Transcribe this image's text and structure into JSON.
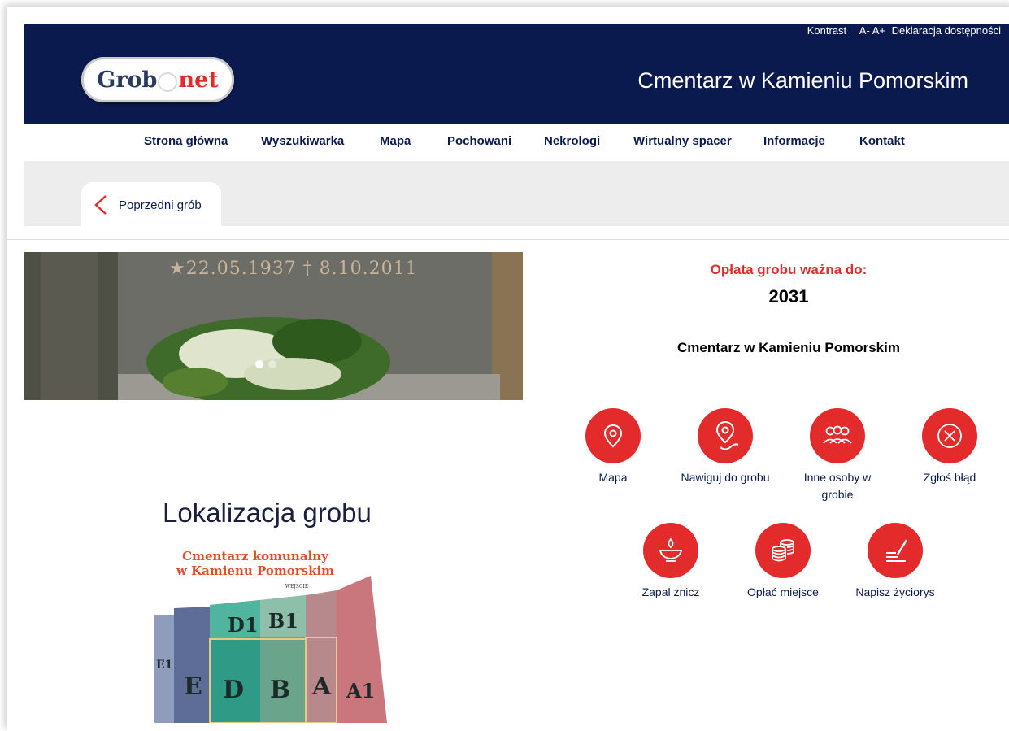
{
  "header": {
    "util": [
      "Kontrast",
      "A- A+",
      "Deklaracja dostępności"
    ],
    "logo": {
      "grob": "Grob",
      "net": "net"
    },
    "site_title": "Cmentarz w Kamieniu Pomorskim"
  },
  "nav": [
    "Strona główna",
    "Wyszukiwarka",
    "Mapa",
    "Pochowani",
    "Nekrologi",
    "Wirtualny spacer",
    "Informacje",
    "Kontakt"
  ],
  "prev_grave": "Poprzedni grób",
  "photo": {
    "dates": "★22.05.1937 † 8.10.2011"
  },
  "fee": {
    "label": "Opłata grobu ważna do:",
    "year": "2031"
  },
  "cemetery_name": "Cmentarz w Kamieniu Pomorskim",
  "actions": [
    {
      "label": "Mapa",
      "icon": "map-pin-icon"
    },
    {
      "label": "Nawiguj do grobu",
      "icon": "navigate-icon"
    },
    {
      "label": "Inne osoby w grobie",
      "icon": "people-icon"
    },
    {
      "label": "Zgłoś błąd",
      "icon": "close-circle-icon"
    },
    {
      "label": "Zapal znicz",
      "icon": "candle-icon"
    },
    {
      "label": "Opłać miejsce",
      "icon": "coins-icon"
    },
    {
      "label": "Napisz życiorys",
      "icon": "write-icon"
    }
  ],
  "location": {
    "title": "Lokalizacja grobu",
    "map_title_1": "Cmentarz komunalny",
    "map_title_2": "w Kamienu Pomorskim",
    "entrance": "WEJŚCIE",
    "sections": [
      "D1",
      "B1",
      "E1",
      "E",
      "D",
      "B",
      "A",
      "A1"
    ]
  },
  "colors": {
    "navy": "#0a1a4e",
    "red": "#e32b2b",
    "gray": "#ededed"
  }
}
